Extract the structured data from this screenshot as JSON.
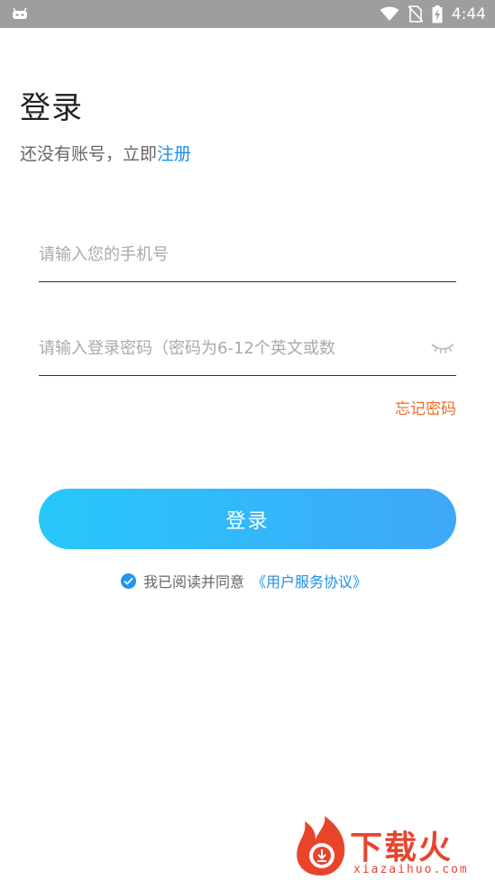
{
  "status_bar": {
    "time": "4:44",
    "icons": [
      "android-debug-icon",
      "wifi-icon",
      "no-sim-icon",
      "battery-charging-icon"
    ]
  },
  "header": {
    "title": "登录",
    "subtitle_prefix": "还没有账号，立即",
    "register_label": "注册"
  },
  "form": {
    "phone_placeholder": "请输入您的手机号",
    "phone_value": "",
    "password_placeholder": "请输入登录密码（密码为6-12个英文或数",
    "password_value": "",
    "eye_icon": "eye-closed-icon",
    "forgot_label": "忘记密码",
    "login_label": "登录"
  },
  "agreement": {
    "checked": true,
    "text": "我已阅读并同意",
    "link_label": "《用户服务协议》"
  },
  "watermark": {
    "brand": "下载火",
    "url": "xiazaihuo.com"
  },
  "colors": {
    "accent_link": "#1e90e8",
    "forgot": "#f06a2a",
    "button_gradient_start": "#27c8fb",
    "button_gradient_end": "#3fa7f9",
    "status_bar": "#9e9e9e",
    "watermark": "#e8442c"
  }
}
